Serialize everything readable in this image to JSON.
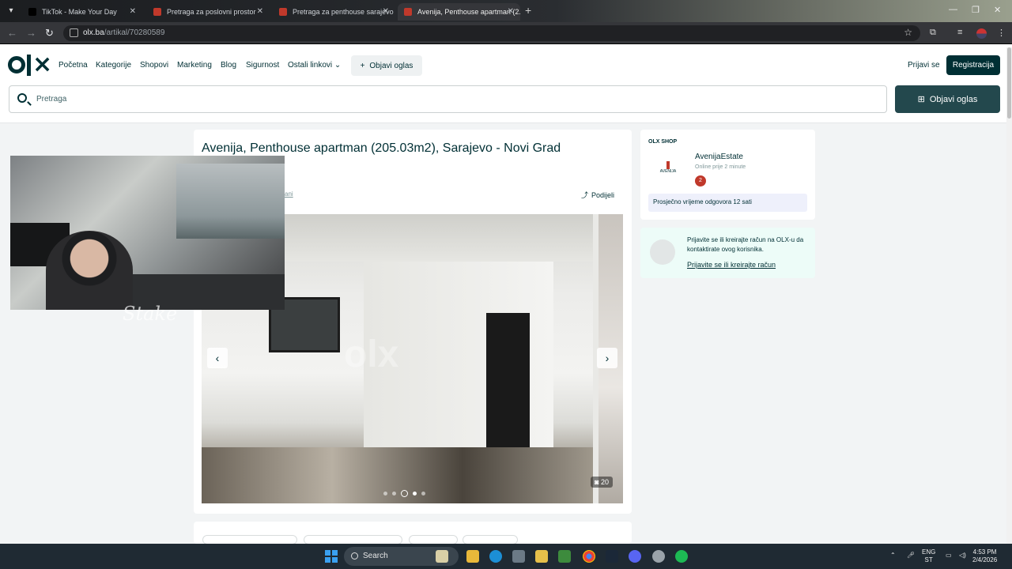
{
  "browser": {
    "tabs": [
      {
        "label": "TikTok - Make Your Day",
        "favicon_color": "#000000"
      },
      {
        "label": "Pretraga za poslovni prostor",
        "favicon_color": "#c0392b"
      },
      {
        "label": "Pretraga za penthouse sarajevo",
        "favicon_color": "#c0392b"
      },
      {
        "label": "Avenija, Penthouse apartman (2...",
        "favicon_color": "#c0392b"
      }
    ],
    "url_host": "olx.ba",
    "url_path": "/artikal/70280589"
  },
  "header": {
    "nav": [
      "Početna",
      "Kategorije",
      "Shopovi",
      "Marketing",
      "Blog",
      "Sigurnost",
      "Ostali linkovi"
    ],
    "post_ad_label": "Objavi oglas",
    "login_label": "Prijavi se",
    "register_label": "Registracija",
    "search_placeholder": "Pretraga",
    "post_ad_big_label": "Objavi oglas"
  },
  "listing": {
    "title": "Avenija, Penthouse apartman (205.03m2), Sarajevo - Novi Grad",
    "crumb_tail": "ani",
    "share_label": "Podijeli",
    "photo_count": "20",
    "active_photo_index": 3
  },
  "seller": {
    "section_label": "OLX SHOP",
    "logo_text": "AVENIJA",
    "name": "AvenijaEstate",
    "online": "Online prije 2 minute",
    "badge": "2",
    "response": "Prosječno vrijeme odgovora 12 sati"
  },
  "login_prompt": {
    "text": "Prijavite se ili kreirajte račun na OLX-u da kontaktirate ovog korisnika.",
    "link": "Prijavite se ili kreirajte račun"
  },
  "overlay": {
    "watermark": "Stake"
  },
  "taskbar": {
    "search_label": "Search",
    "lang_1": "ENG",
    "lang_2": "ST",
    "time": "4:53 PM",
    "date": "2/4/2026"
  },
  "colors": {
    "olx_dark": "#002f34",
    "button_teal": "#23484d",
    "seller_badge": "#c0392b"
  }
}
